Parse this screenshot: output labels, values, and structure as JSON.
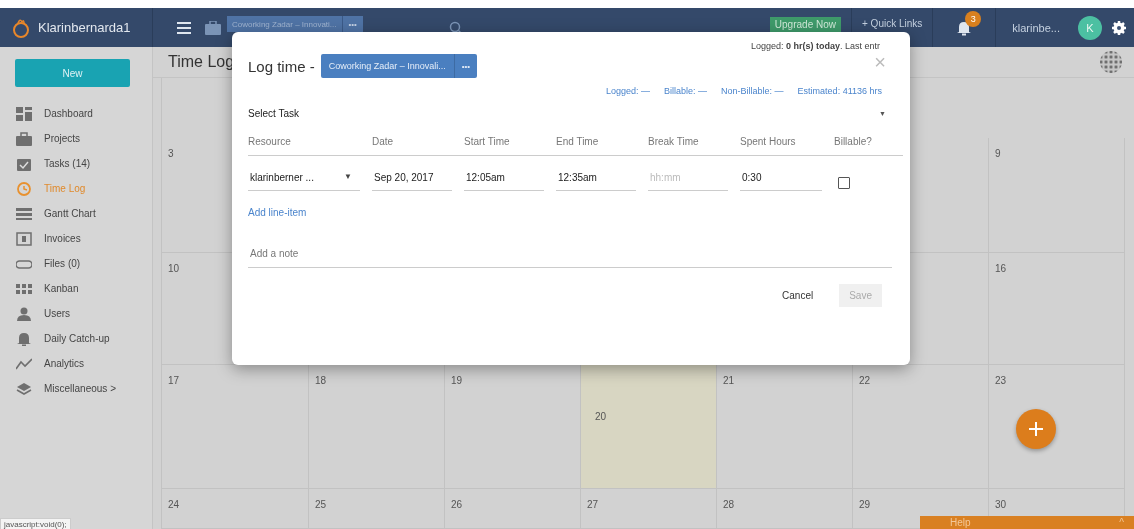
{
  "header": {
    "brand": "Klarinbernarda1",
    "project": "Coworking Zadar – Innovati...",
    "project_more": "•••",
    "upgrade": "Upgrade Now",
    "quick_links": "+ Quick Links",
    "notifications": "3",
    "user": "klarinbe...",
    "avatar": "K"
  },
  "sidebar": {
    "new_button": "New",
    "items": [
      {
        "label": "Dashboard",
        "selected": false
      },
      {
        "label": "Projects",
        "selected": false
      },
      {
        "label": "Tasks (14)",
        "selected": false
      },
      {
        "label": "Time Log",
        "selected": true
      },
      {
        "label": "Gantt Chart",
        "selected": false
      },
      {
        "label": "Invoices",
        "selected": false
      },
      {
        "label": "Files  (0)",
        "selected": false
      },
      {
        "label": "Kanban",
        "selected": false
      },
      {
        "label": "Users",
        "selected": false
      },
      {
        "label": "Daily Catch-up",
        "selected": false
      },
      {
        "label": "Analytics",
        "selected": false
      },
      {
        "label": "Miscellaneous >",
        "selected": false
      }
    ]
  },
  "main": {
    "title": "Time Log"
  },
  "calendar": {
    "weeks": [
      [
        {
          "day": "3",
          "today": false
        },
        {
          "day": "9",
          "today": false
        }
      ],
      [
        {
          "day": "10",
          "today": false
        },
        {
          "day": "16",
          "today": false
        }
      ],
      [
        {
          "day": "17",
          "today": false
        },
        {
          "day": "18",
          "today": false
        },
        {
          "day": "19",
          "today": false
        },
        {
          "day": "20",
          "today": true
        },
        {
          "day": "21",
          "today": false
        },
        {
          "day": "22",
          "today": false
        },
        {
          "day": "23",
          "today": false
        }
      ],
      [
        {
          "day": "24",
          "today": false
        },
        {
          "day": "25",
          "today": false
        },
        {
          "day": "26",
          "today": false
        },
        {
          "day": "27",
          "today": false
        },
        {
          "day": "28",
          "today": false
        },
        {
          "day": "29",
          "today": false
        },
        {
          "day": "30",
          "today": false
        }
      ]
    ]
  },
  "modal": {
    "title": "Log time -",
    "project": "Coworking Zadar – Innovali...",
    "project_more": "•••",
    "logged_info": "Logged: **0 hr(s) today**. Last entr",
    "close": "×",
    "stats": [
      "Logged: —",
      "Billable: —",
      "Non-Billable: —",
      "Estimated: 41136 hrs"
    ],
    "task_select": "Select Task",
    "task_caret": "▼",
    "columns": [
      "Resource",
      "Date",
      "Start Time",
      "End Time",
      "Break Time",
      "Spent Hours",
      "Billable?"
    ],
    "row": {
      "resource": "klarinberner ...",
      "resource_caret": "▼",
      "date": "Sep 20, 2017",
      "start": "12:05am",
      "end": "12:35am",
      "break_placeholder": "hh:mm",
      "spent": "0:30",
      "billable": false
    },
    "add_line": "Add line-item",
    "note_placeholder": "Add a note",
    "buttons": [
      {
        "label": "Cancel",
        "disabled": false
      },
      {
        "label": "Save",
        "disabled": true
      }
    ]
  },
  "status_bar": "javascript:void(0);",
  "help": {
    "label": "Help",
    "caret": "^"
  }
}
